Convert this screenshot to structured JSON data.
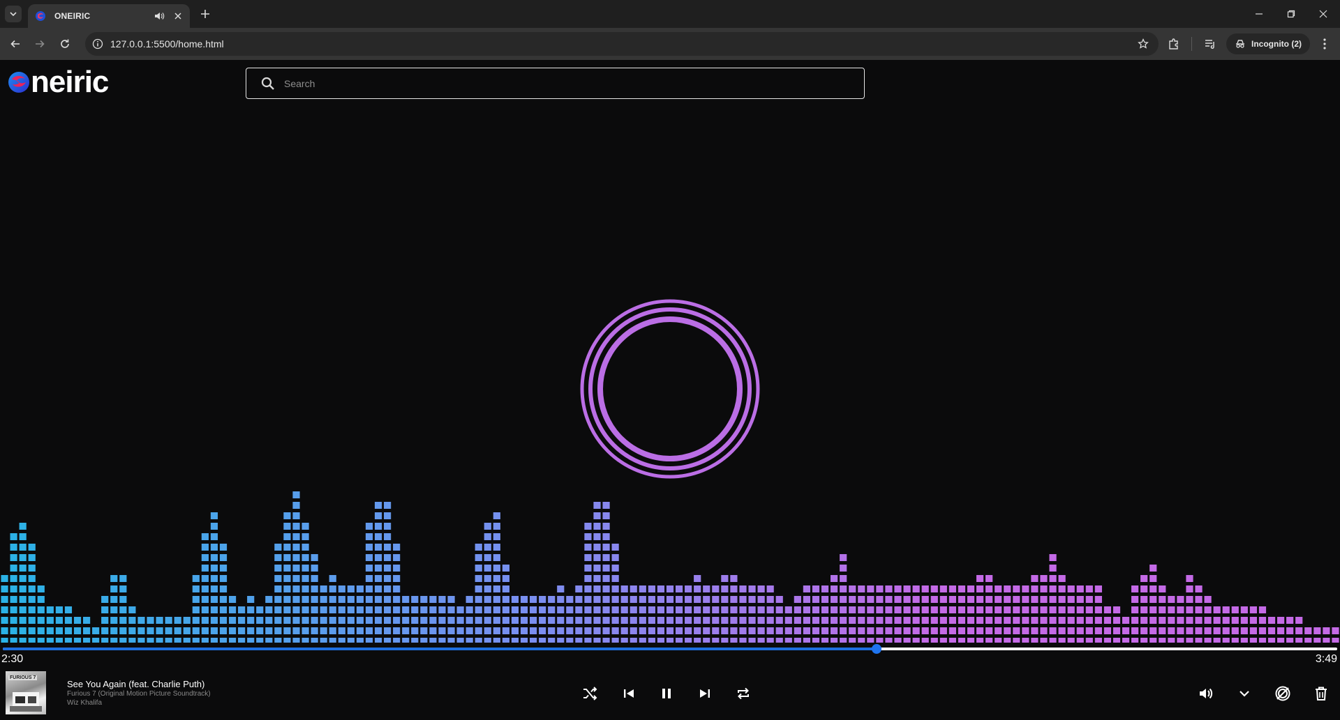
{
  "browser": {
    "tab_title": "ONEIRIC",
    "url": "127.0.0.1:5500/home.html",
    "incognito_label": "Incognito (2)"
  },
  "app": {
    "logo_text": "neiric",
    "search_placeholder": "Search",
    "accent_color": "#1f74ef",
    "ring_color": "#bb6ee5"
  },
  "playback": {
    "current_time": "2:30",
    "total_time": "3:49",
    "progress": 0.655
  },
  "now_playing": {
    "title": "See You Again (feat. Charlie Puth)",
    "album": "Furious 7 (Original Motion Picture Soundtrack)",
    "artist": "Wiz Khalifa",
    "cover_text": "FURIOUS 7"
  },
  "controls": {
    "icons": [
      "shuffle-icon",
      "previous-icon",
      "pause-icon",
      "next-icon",
      "repeat-icon",
      "volume-icon",
      "chevron-down-icon",
      "rings-icon",
      "trash-icon"
    ]
  },
  "visualizer": {
    "levels": [
      7,
      11,
      12,
      10,
      6,
      4,
      4,
      4,
      3,
      3,
      2,
      5,
      7,
      7,
      4,
      3,
      3,
      3,
      3,
      3,
      3,
      7,
      11,
      13,
      10,
      5,
      4,
      5,
      4,
      5,
      10,
      13,
      15,
      12,
      9,
      6,
      7,
      6,
      6,
      6,
      12,
      14,
      14,
      10,
      5,
      5,
      5,
      5,
      5,
      5,
      4,
      5,
      10,
      12,
      13,
      8,
      5,
      5,
      5,
      5,
      5,
      6,
      5,
      6,
      12,
      14,
      14,
      10,
      6,
      6,
      6,
      6,
      6,
      6,
      6,
      6,
      7,
      6,
      6,
      7,
      7,
      6,
      6,
      6,
      6,
      5,
      4,
      5,
      6,
      6,
      6,
      7,
      9,
      6,
      6,
      6,
      6,
      6,
      6,
      6,
      6,
      6,
      6,
      6,
      6,
      6,
      6,
      7,
      7,
      6,
      6,
      6,
      6,
      7,
      7,
      9,
      7,
      6,
      6,
      6,
      6,
      4,
      4,
      3,
      6,
      7,
      8,
      6,
      5,
      5,
      7,
      6,
      5,
      4,
      4,
      4,
      4,
      4,
      4,
      3,
      3,
      3,
      3,
      2,
      2,
      2,
      2
    ],
    "color_start": "#2bb2e6",
    "color_mid": "#7b8ef0",
    "color_end": "#c46ae6"
  }
}
